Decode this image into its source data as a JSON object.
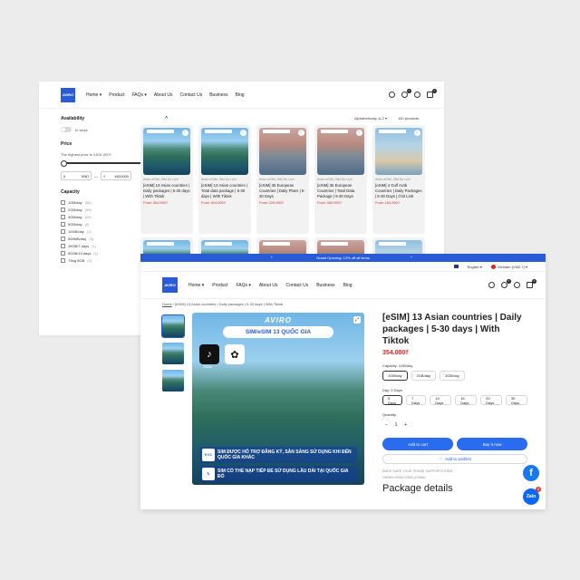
{
  "back": {
    "nav": [
      "Home ▾",
      "Product",
      "FAQs ▾",
      "About Us",
      "Contact Us",
      "Business",
      "Blog"
    ],
    "cart_count": "0",
    "wish_count": "0",
    "logo": "AVIRO",
    "sidebar": {
      "availability_label": "Availability",
      "in_stock_label": "In stock",
      "price_label": "Price",
      "price_note": "The highest price is 4,631,000₫",
      "price_min": "0",
      "price_currency": "VND",
      "price_max": "4631000",
      "price_to": "—",
      "capacity_label": "Capacity",
      "capacity_items": [
        {
          "label": "1GB/day",
          "count": "(56)"
        },
        {
          "label": "2GB/day",
          "count": "(59)"
        },
        {
          "label": "3GB/day",
          "count": "(25)"
        },
        {
          "label": "5GB/day",
          "count": "(4)"
        },
        {
          "label": "10GB/day",
          "count": "(1)"
        },
        {
          "label": "500MB/day",
          "count": "(3)"
        },
        {
          "label": "15GB/7 days",
          "count": "(1)"
        },
        {
          "label": "50GB/10 days",
          "count": "(1)"
        },
        {
          "label": "Tổng 8GB",
          "count": "(1)"
        }
      ]
    },
    "toolbar": {
      "sort": "Alphabetically, A-Z ▾",
      "count": "100 products"
    },
    "products": [
      {
        "vendor": "Avivo eSIM, SIM Du Lịch",
        "title": "[eSIM] 13 Asian countries | Daily packages | 5-30 days | With Tiktok",
        "price": "From 354,000₫",
        "img": "g-bay"
      },
      {
        "vendor": "Avivo eSIM, SIM Du Lịch",
        "title": "[eSIM] 13 Asian countries | Total data package | 5-30 days | With Tiktok",
        "price": "From 404,000₫",
        "img": "g-bay"
      },
      {
        "vendor": "Avivo eSIM, SIM Du Lịch",
        "title": "[eSIM] 35 European Countries | Daily Plans | 5-30 Days",
        "price": "From 220,000₫",
        "img": "g-eu"
      },
      {
        "vendor": "Avivo eSIM, SIM Du Lịch",
        "title": "[eSIM] 35 European Countries | Total Data Package | 5-30 Days",
        "price": "From 460,000₫",
        "img": "g-eu"
      },
      {
        "vendor": "Avivo eSIM, SIM Du Lịch",
        "title": "[eSIM] 4 Gulf Arab Countries | Daily Packages | 5-30 Days | Chit Link",
        "price": "From 160,000₫",
        "img": "g-gulf"
      }
    ]
  },
  "front": {
    "announcement": "Grand Opening: 12% off all items",
    "language": "English ▾",
    "currency": "Vietnam (VND ₫) ▾",
    "logo": "AVIRO",
    "nav": [
      "Home ▾",
      "Product",
      "FAQs ▾",
      "About Us",
      "Contact Us",
      "Business",
      "Blog"
    ],
    "cart_count": "0",
    "wish_count": "0",
    "breadcrumb_home": "Home",
    "breadcrumb_current": "[eSIM] 13 Asian countries | Daily packages | 5-30 days | With Tiktok",
    "image": {
      "brand": "AVIRO",
      "pill": "SIM/eSIM 13 QUỐC GIA",
      "tiktok_label": "TikTok",
      "feature1": "SIM ĐƯỢC HỖ TRỢ ĐĂNG KÝ, SẴN SÀNG SỬ DỤNG KHI ĐẾN QUỐC GIA KHÁC",
      "feature1_icon": "KYC",
      "feature2": "SIM CÓ THỂ NẠP TIẾP ĐỂ SỬ DỤNG LÂU DÀI TẠI QUỐC GIA ĐÓ",
      "feature2_icon": "↻"
    },
    "product": {
      "title": "[eSIM] 13 Asian countries | Daily packages | 5-30 days | With Tiktok",
      "price": "354.000₫",
      "capacity_label": "Capacity: 1GB/day",
      "capacity_options": [
        "1GB/day",
        "2GB/day",
        "3GB/day"
      ],
      "day_label": "Day: 5 Days",
      "day_options": [
        "5 Days",
        "7 Days",
        "10 Days",
        "15 Days",
        "20 Days",
        "30 Days"
      ],
      "quantity_label": "Quantity",
      "quantity": "1",
      "add_to_cart": "Add to cart",
      "buy_now": "Buy it now",
      "wishlist": "Add to wishlist",
      "support_text": "MAKE SURE YOUR PHONE SUPPORTS ESIM",
      "support_sub": "ORIGIN: HONG KONG (CHINA)",
      "package_details": "Package details"
    },
    "zalo": "Zalo",
    "zalo_badge": "1"
  }
}
